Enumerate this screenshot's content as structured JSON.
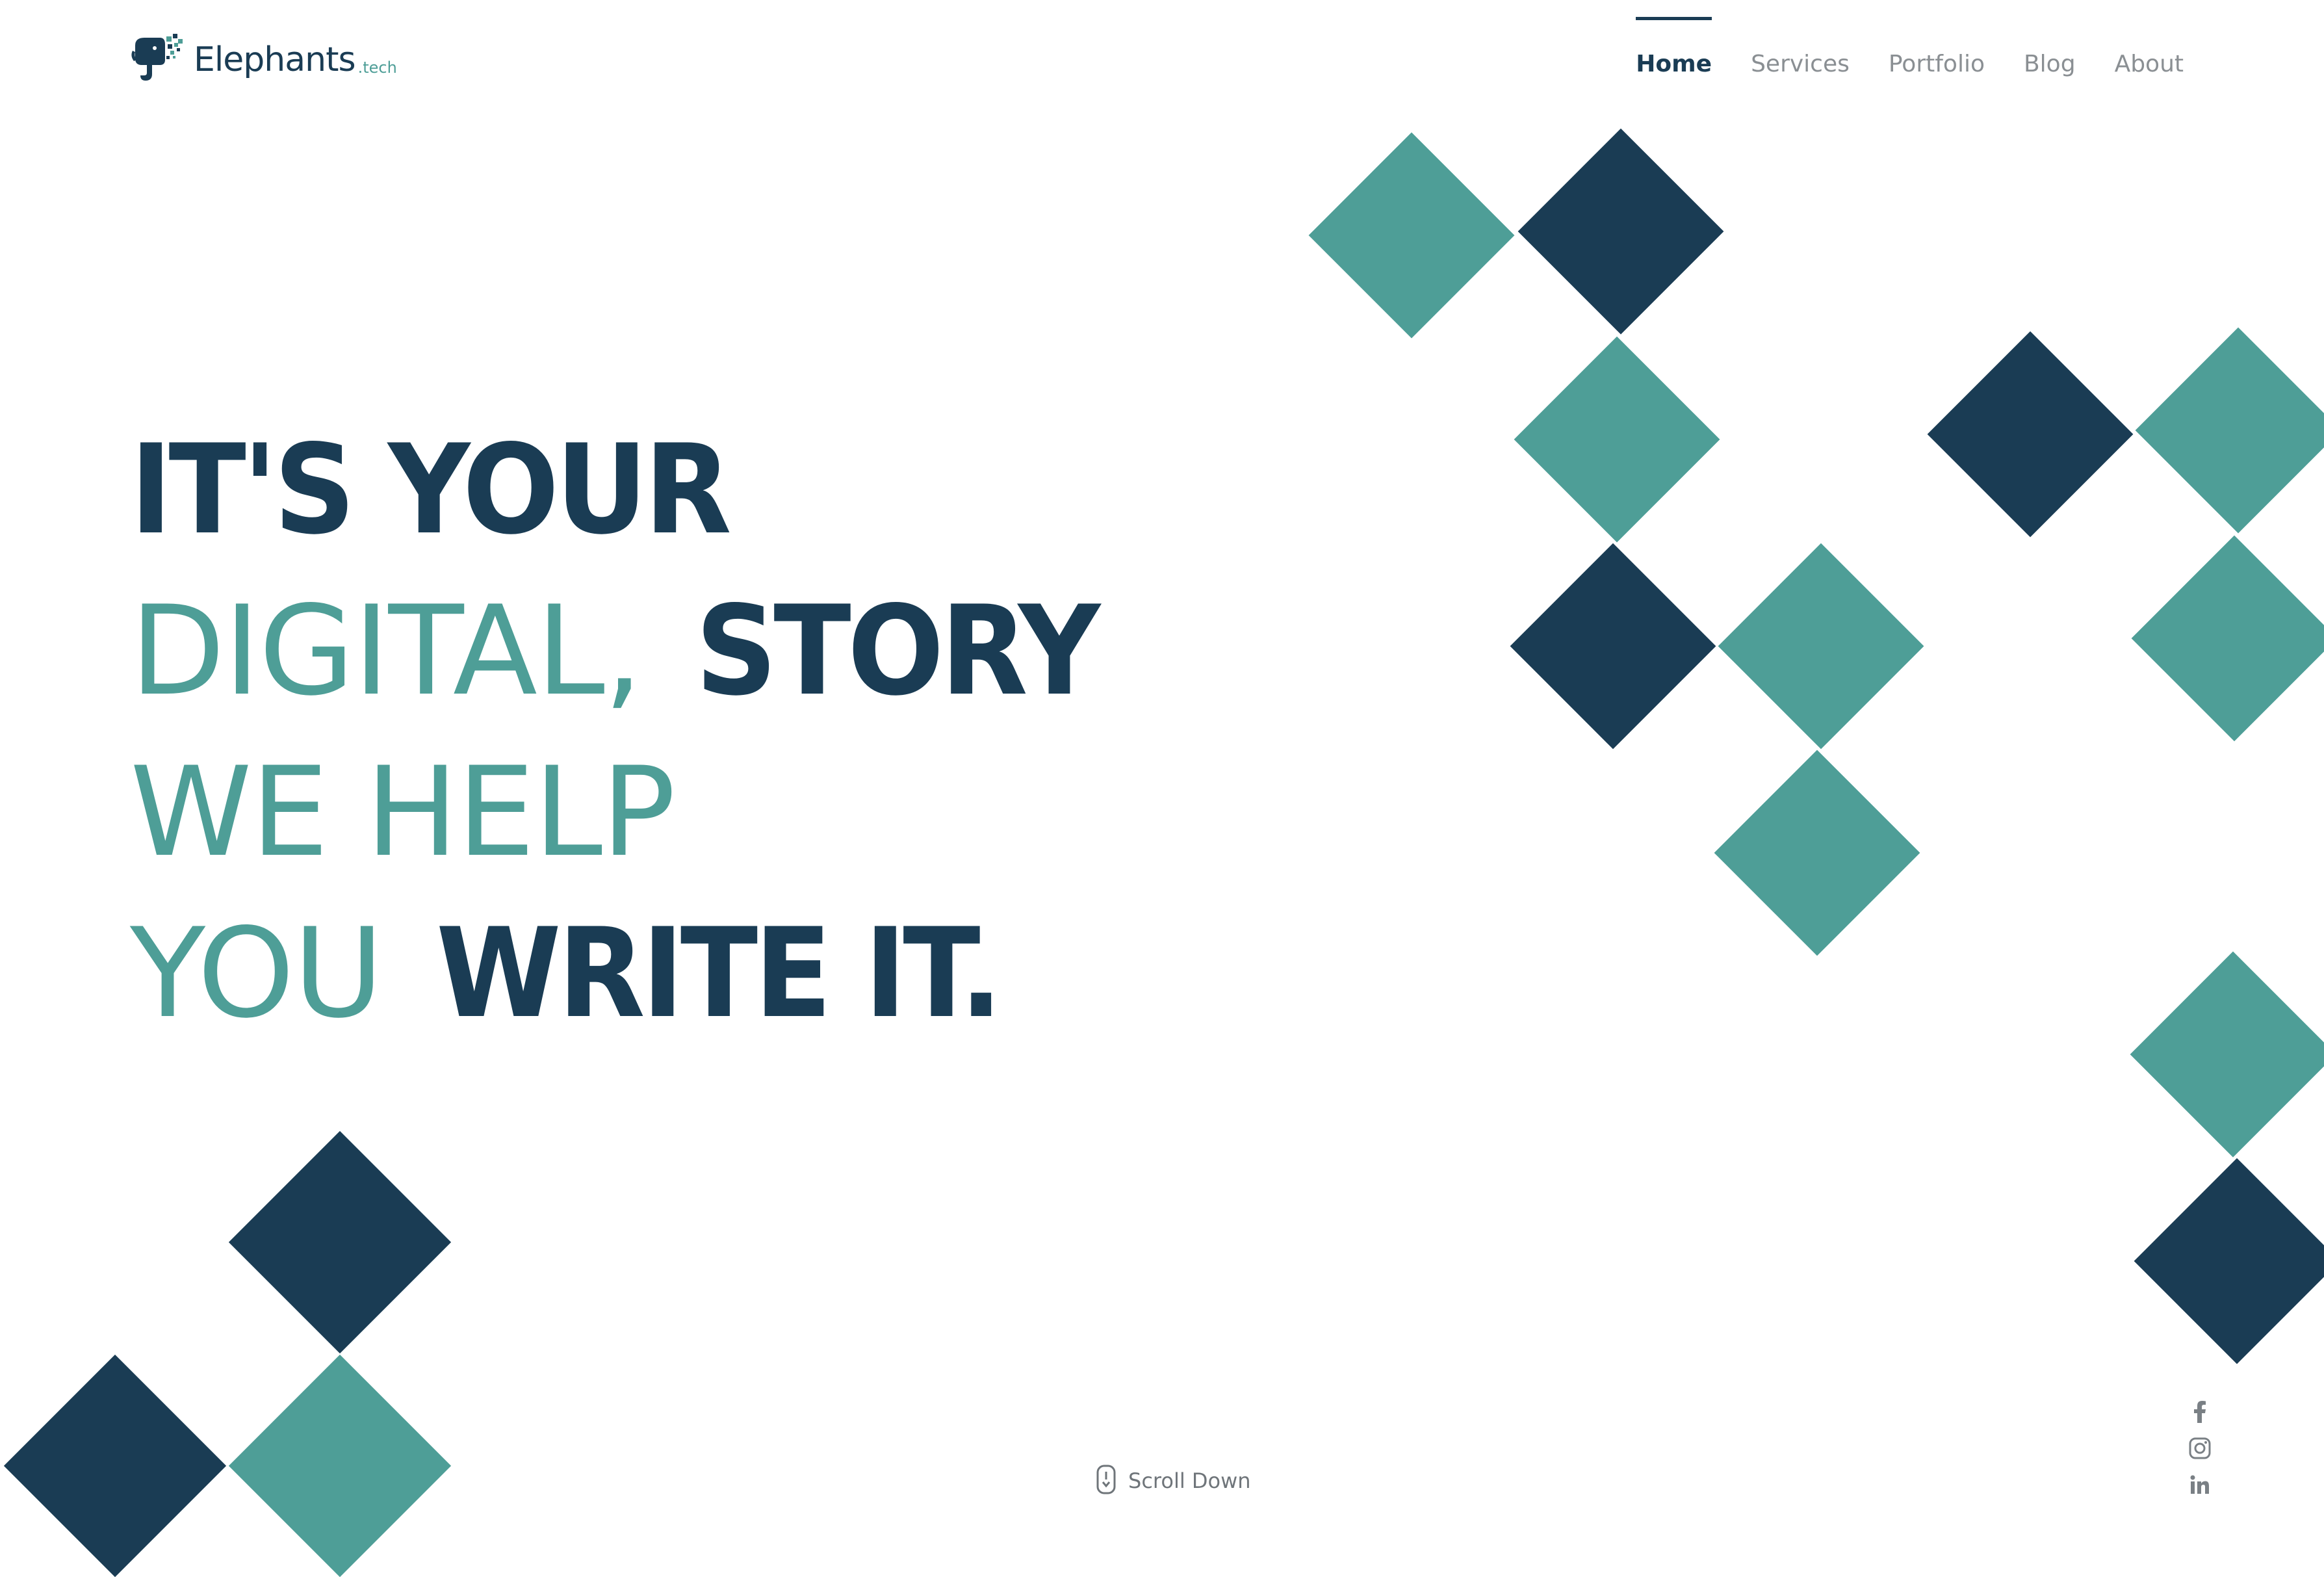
{
  "brand": {
    "name": "Elephants",
    "tld": ".tech",
    "logo_icon": "elephant-pixel-logo-icon"
  },
  "nav": {
    "items": [
      {
        "label": "Home",
        "active": true
      },
      {
        "label": "Services",
        "active": false
      },
      {
        "label": "Portfolio",
        "active": false
      },
      {
        "label": "Blog",
        "active": false
      },
      {
        "label": "About",
        "active": false
      }
    ]
  },
  "hero": {
    "line1_bold": "IT'S YOUR",
    "line2_light": "DIGITAL,",
    "line2_bold": "STORY",
    "line3_light": "WE HELP",
    "line4_light": "YOU",
    "line4_bold": "WRITE IT."
  },
  "scroll": {
    "label": "Scroll Down",
    "icon": "mouse-scroll-icon"
  },
  "socials": {
    "items": [
      {
        "icon": "facebook-icon"
      },
      {
        "icon": "instagram-icon"
      },
      {
        "icon": "linkedin-icon"
      }
    ]
  },
  "colors": {
    "navy": "#1a3c54",
    "teal": "#4e9e97",
    "muted": "#8a8f93",
    "background": "#ffffff"
  }
}
